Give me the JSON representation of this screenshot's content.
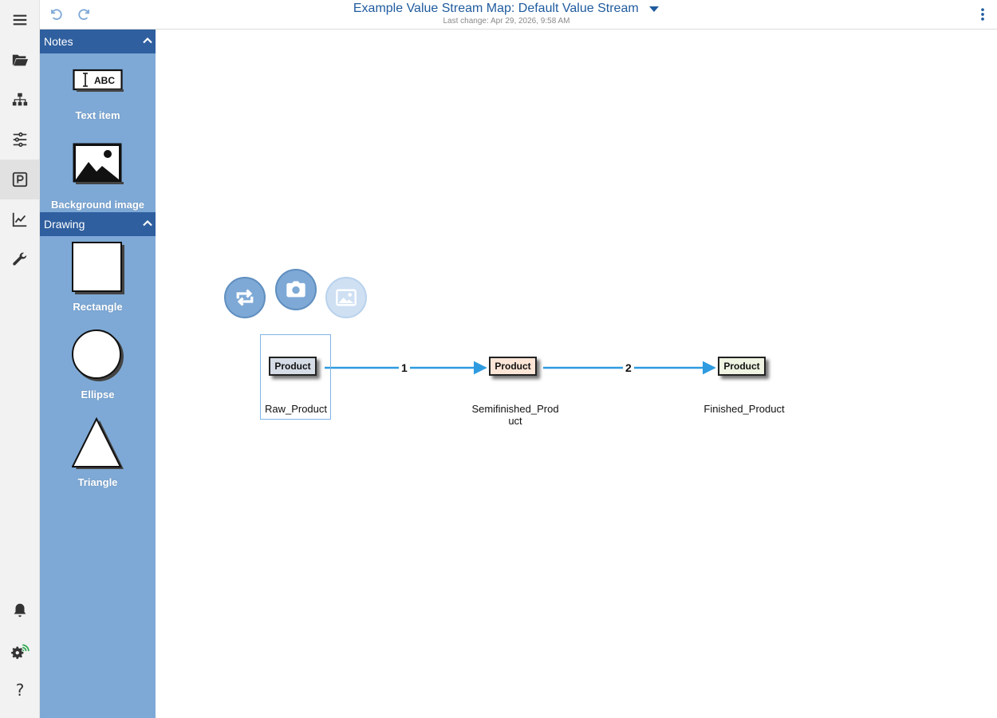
{
  "header": {
    "title": "Example Value Stream Map: Default Value Stream",
    "last_change": "Last change: Apr 29, 2026, 9:58 AM"
  },
  "rail": {
    "items": [
      "menu-icon",
      "folder-open-icon",
      "hierarchy-icon",
      "process-flow-icon",
      "parking-icon",
      "chart-line-icon",
      "wrench-icon"
    ],
    "bottom": [
      "bell-icon",
      "settings-wifi-icon",
      "help-icon"
    ],
    "help_glyph": "?"
  },
  "palette": {
    "notes": {
      "title": "Notes",
      "items": [
        {
          "label": "Text item",
          "icon_text": "ABC"
        },
        {
          "label": "Background image"
        }
      ]
    },
    "drawing": {
      "title": "Drawing",
      "items": [
        {
          "label": "Rectangle"
        },
        {
          "label": "Ellipse"
        },
        {
          "label": "Triangle"
        }
      ]
    }
  },
  "canvas": {
    "nodes": [
      {
        "box": "Product",
        "label": "Raw_Product",
        "color": "#d5dce6",
        "selected": true
      },
      {
        "box": "Product",
        "label": "Semifinished_Product",
        "color": "#fbe5d6",
        "selected": false
      },
      {
        "box": "Product",
        "label": "Finished_Product",
        "color": "#eef3e2",
        "selected": false
      }
    ],
    "edges": [
      {
        "label": "1"
      },
      {
        "label": "2"
      }
    ],
    "edge_color": "#2e9be0"
  },
  "colors": {
    "accent": "#1f5b9e",
    "panel": "#7ea9d6",
    "section_header": "#2f5f9f"
  }
}
